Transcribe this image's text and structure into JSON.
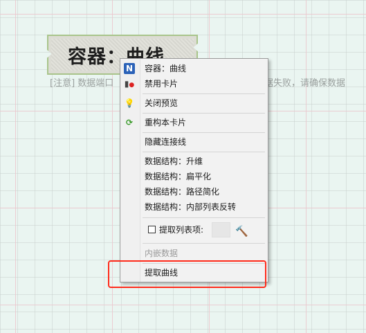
{
  "canvas": {
    "node_title": "容器：曲线",
    "note_text": "[注意] 数据端口",
    "note_tail": "据失败，请确保数据",
    "colors": {
      "background": "#eaf5f1",
      "node_border": "#a8c48a",
      "highlight": "#ff2a1a"
    }
  },
  "menu": {
    "items": [
      {
        "label": "容器：曲线",
        "icon": "n-badge-icon"
      },
      {
        "label": "禁用卡片",
        "icon": "disable-card-icon"
      },
      {
        "label": "关闭预览",
        "icon": "lightbulb-icon"
      },
      {
        "label": "重构本卡片",
        "icon": "refresh-icon"
      },
      {
        "label": "隐藏连接线"
      },
      {
        "label": "数据结构：升维"
      },
      {
        "label": "数据结构：扁平化"
      },
      {
        "label": "数据结构：路径简化"
      },
      {
        "label": "数据结构：内部列表反转"
      },
      {
        "label": "提取列表项:",
        "checked": false
      },
      {
        "label": "内嵌数据",
        "disabled": true
      },
      {
        "label": "提取曲线"
      }
    ]
  }
}
